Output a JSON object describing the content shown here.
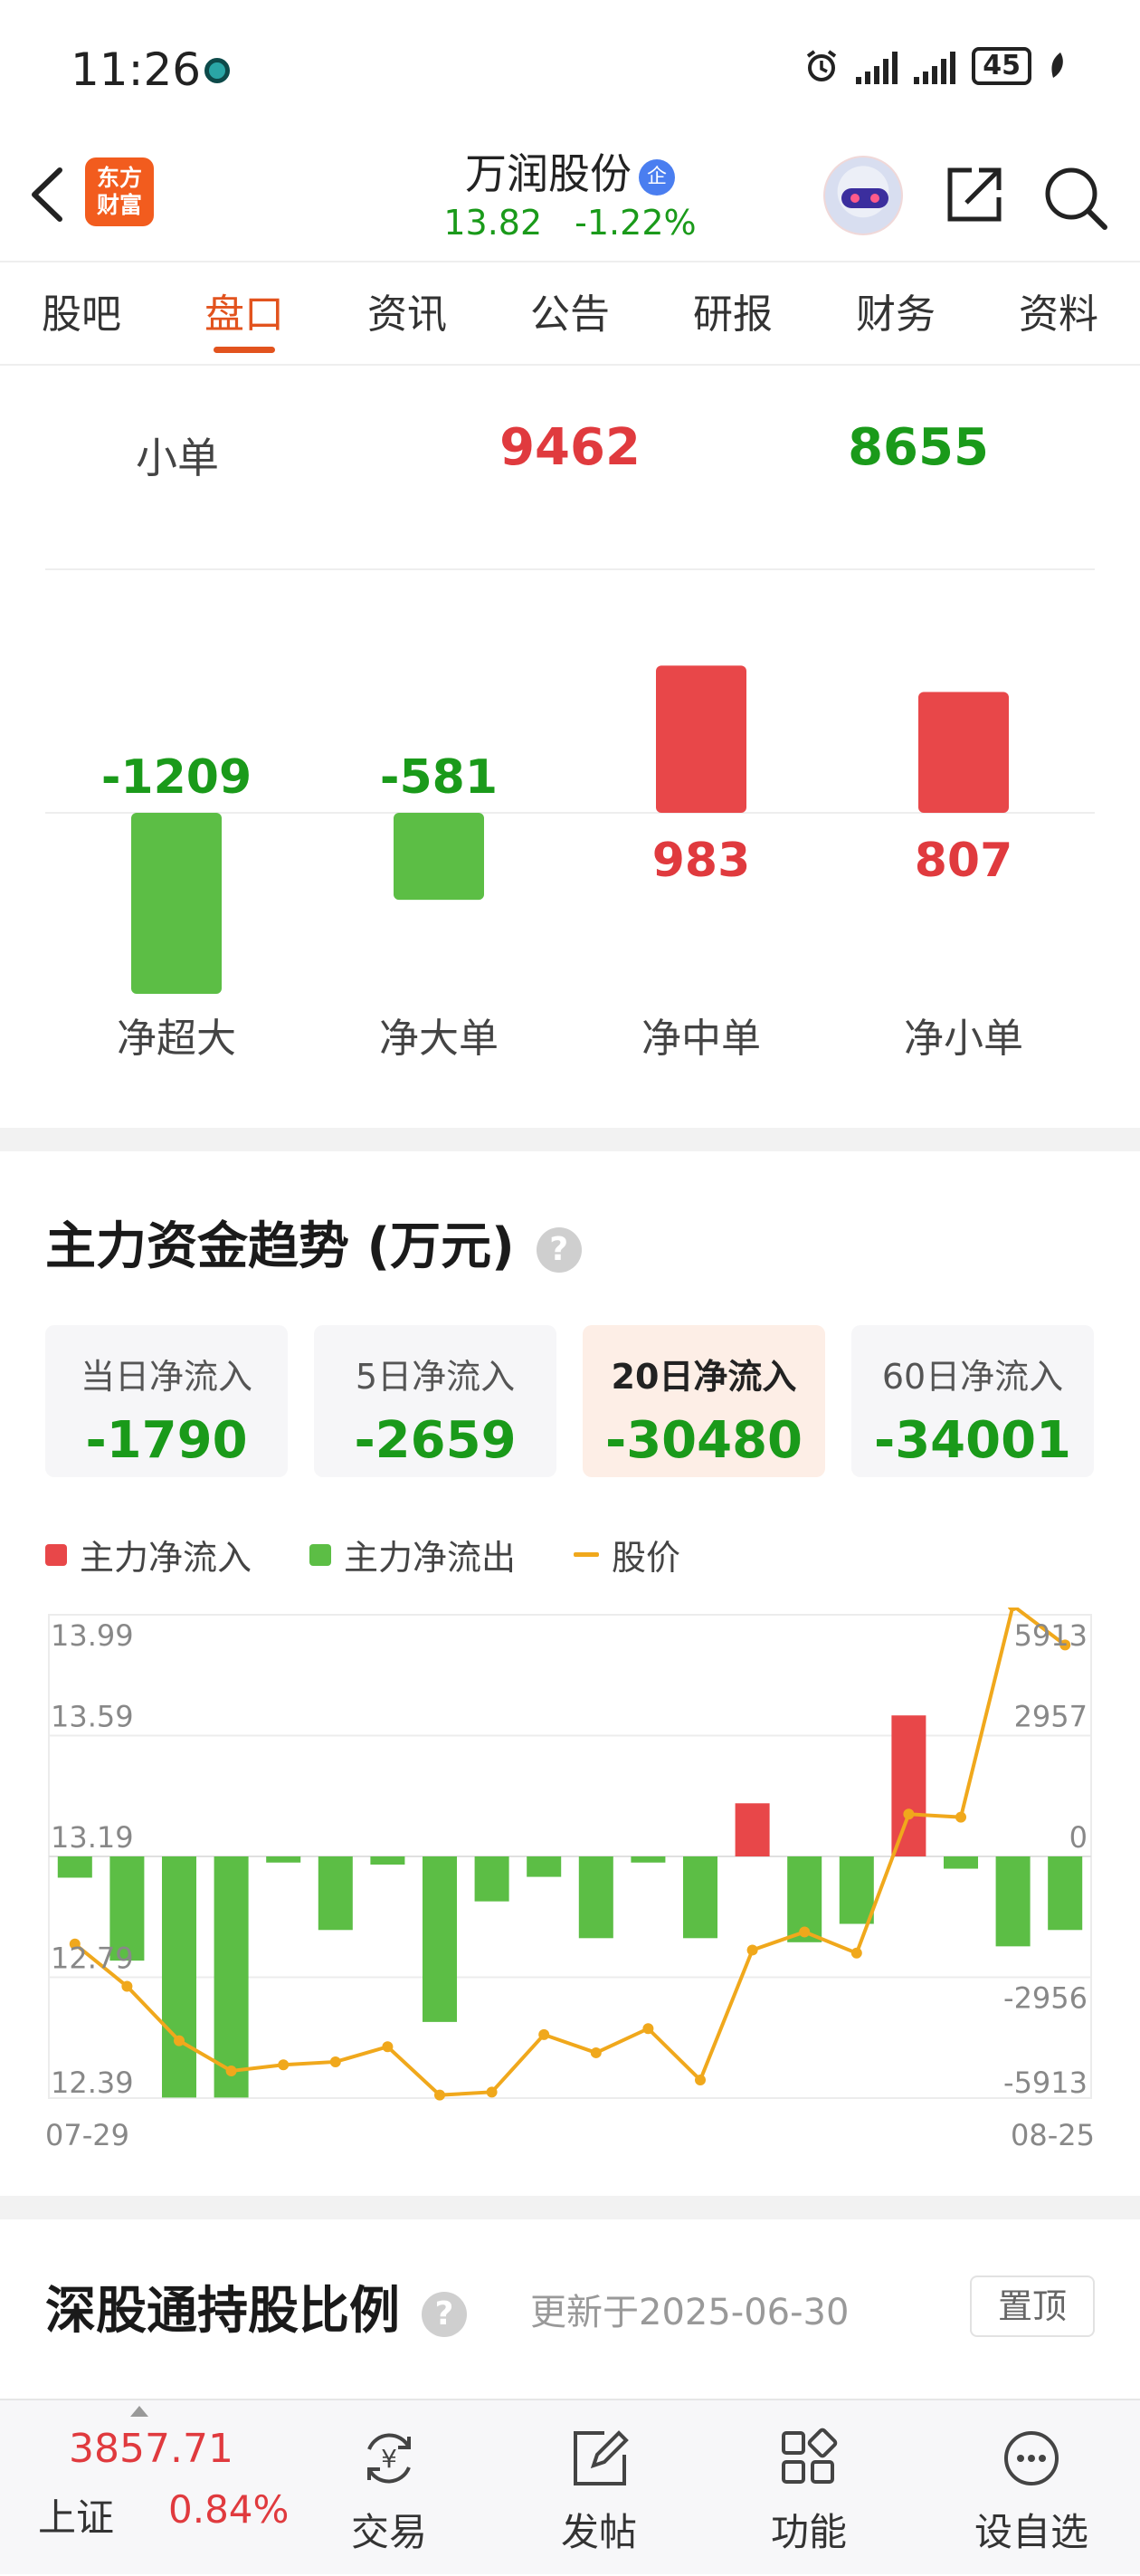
{
  "status": {
    "time": "11:26",
    "battery": "45"
  },
  "header": {
    "logo_text": "东方\n财富",
    "stock_name": "万润股份",
    "badge": "企",
    "price": "13.82",
    "change_pct": "-1.22%"
  },
  "tabs": [
    "股吧",
    "盘口",
    "资讯",
    "公告",
    "研报",
    "财务",
    "资料"
  ],
  "active_tab": "盘口",
  "orders": {
    "rows": [
      {
        "label": "小单",
        "buy": "9462",
        "sell": "8655"
      }
    ]
  },
  "net_flow": {
    "items": [
      {
        "label": "净超大",
        "value": -1209,
        "display": "-1209"
      },
      {
        "label": "净大单",
        "value": -581,
        "display": "-581"
      },
      {
        "label": "净中单",
        "value": 983,
        "display": "983"
      },
      {
        "label": "净小单",
        "value": 807,
        "display": "807"
      }
    ],
    "colors": {
      "positive": "#e84749",
      "negative": "#5cbe45"
    }
  },
  "trend": {
    "title": "主力资金趋势 (万元)",
    "cards": [
      {
        "label": "当日净流入",
        "value": "-1790",
        "active": false
      },
      {
        "label": "5日净流入",
        "value": "-2659",
        "active": false
      },
      {
        "label": "20日净流入",
        "value": "-30480",
        "active": true
      },
      {
        "label": "60日净流入",
        "value": "-34001",
        "active": false
      }
    ],
    "legend": [
      {
        "label": "主力净流入",
        "color": "#e84749",
        "kind": "box"
      },
      {
        "label": "主力净流出",
        "color": "#5cbe45",
        "kind": "box"
      },
      {
        "label": "股价",
        "color": "#f0a81c",
        "kind": "line"
      }
    ]
  },
  "chart_data": {
    "type": "bar",
    "x_start": "07-29",
    "x_end": "08-25",
    "left_axis_ticks": [
      "13.99",
      "13.59",
      "13.19",
      "12.79",
      "12.39"
    ],
    "right_axis_ticks": [
      "5913",
      "2957",
      "0",
      "-2956",
      "-5913"
    ],
    "left_ylim": [
      12.39,
      13.99
    ],
    "right_ylim": [
      -5913,
      5913
    ],
    "grid": true,
    "series": [
      {
        "name": "主力净流入/流出",
        "values": [
          -520,
          -2550,
          -5900,
          -5900,
          -150,
          -1800,
          -200,
          -4050,
          -1100,
          -500,
          -2000,
          -150,
          -2000,
          1300,
          -2100,
          -1650,
          3450,
          -300,
          -2200,
          -1800
        ]
      },
      {
        "name": "股价",
        "values": [
          12.9,
          12.76,
          12.58,
          12.48,
          12.5,
          12.51,
          12.56,
          12.4,
          12.41,
          12.6,
          12.54,
          12.62,
          12.45,
          12.88,
          12.94,
          12.87,
          13.33,
          13.32,
          14.02,
          13.89
        ]
      }
    ]
  },
  "holding": {
    "title": "深股通持股比例",
    "updated": "更新于2025-06-30",
    "pin": "置顶"
  },
  "bottom": {
    "index_value": "3857.71",
    "index_name": "上证",
    "index_pct": "0.84%",
    "nav": [
      "交易",
      "发帖",
      "功能",
      "设自选"
    ]
  }
}
